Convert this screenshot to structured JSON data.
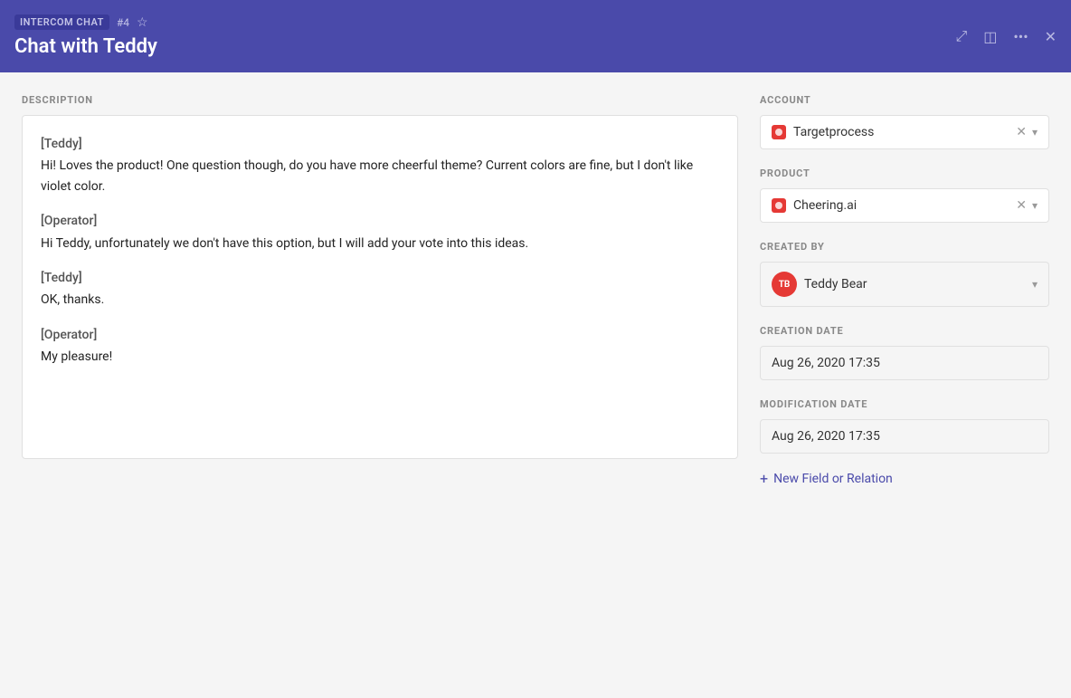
{
  "header": {
    "badge": "INTERCOM CHAT",
    "id": "#4",
    "title": "Chat with Teddy",
    "actions": [
      "expand-icon",
      "layout-icon",
      "more-icon",
      "close-icon"
    ]
  },
  "left": {
    "section_label": "DESCRIPTION",
    "messages": [
      {
        "type": "speaker",
        "text": "[Teddy]"
      },
      {
        "type": "text",
        "text": "Hi! Loves the product! One question though, do you have more cheerful theme? Current colors are fine, but I don't like violet color."
      },
      {
        "type": "speaker",
        "text": "[Operator]"
      },
      {
        "type": "text",
        "text": "Hi Teddy, unfortunately we don't have this option, but I will add your vote into this ideas."
      },
      {
        "type": "speaker",
        "text": "[Teddy]"
      },
      {
        "type": "text",
        "text": "OK, thanks."
      },
      {
        "type": "speaker",
        "text": "[Operator]"
      },
      {
        "type": "text",
        "text": "My pleasure!"
      }
    ]
  },
  "right": {
    "account": {
      "label": "ACCOUNT",
      "value": "Targetprocess"
    },
    "product": {
      "label": "PRODUCT",
      "value": "Cheering.ai"
    },
    "created_by": {
      "label": "CREATED BY",
      "avatar": "TB",
      "name": "Teddy Bear"
    },
    "creation_date": {
      "label": "CREATION DATE",
      "value": "Aug 26, 2020 17:35"
    },
    "modification_date": {
      "label": "MODIFICATION DATE",
      "value": "Aug 26, 2020 17:35"
    },
    "new_field_label": "New Field or Relation"
  }
}
